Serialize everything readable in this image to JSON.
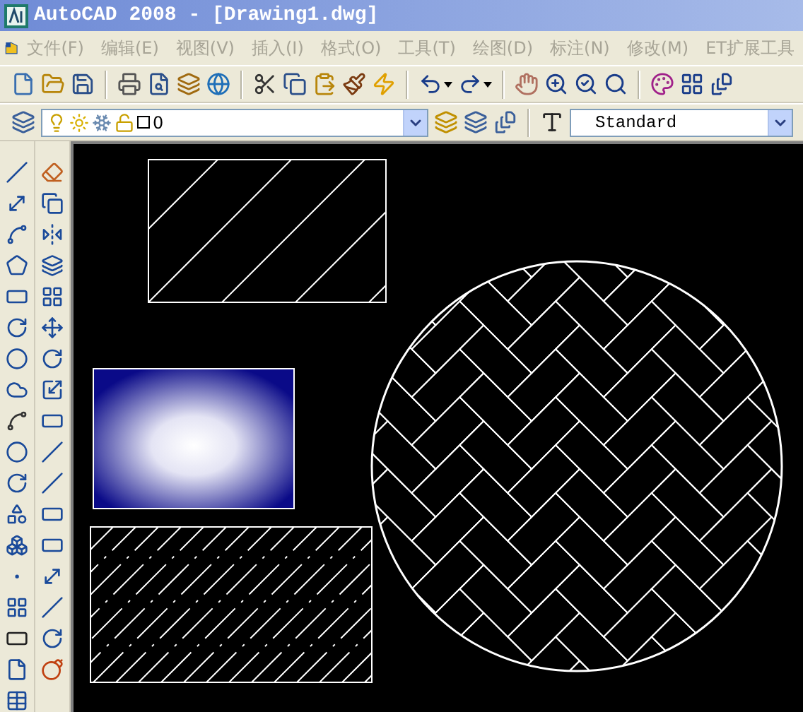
{
  "window": {
    "title": "AutoCAD 2008 - [Drawing1.dwg]"
  },
  "menu": [
    {
      "label": "文件(F)",
      "disabled": true
    },
    {
      "label": "编辑(E)",
      "disabled": true
    },
    {
      "label": "视图(V)",
      "disabled": true
    },
    {
      "label": "插入(I)",
      "disabled": true
    },
    {
      "label": "格式(O)",
      "disabled": true
    },
    {
      "label": "工具(T)",
      "disabled": true
    },
    {
      "label": "绘图(D)",
      "disabled": true
    },
    {
      "label": "标注(N)",
      "disabled": true
    },
    {
      "label": "修改(M)",
      "disabled": true
    },
    {
      "label": "ET扩展工具",
      "disabled": true
    }
  ],
  "layer_toolbar": {
    "layer": "0"
  },
  "style_toolbar": {
    "text_style": "Standard"
  }
}
